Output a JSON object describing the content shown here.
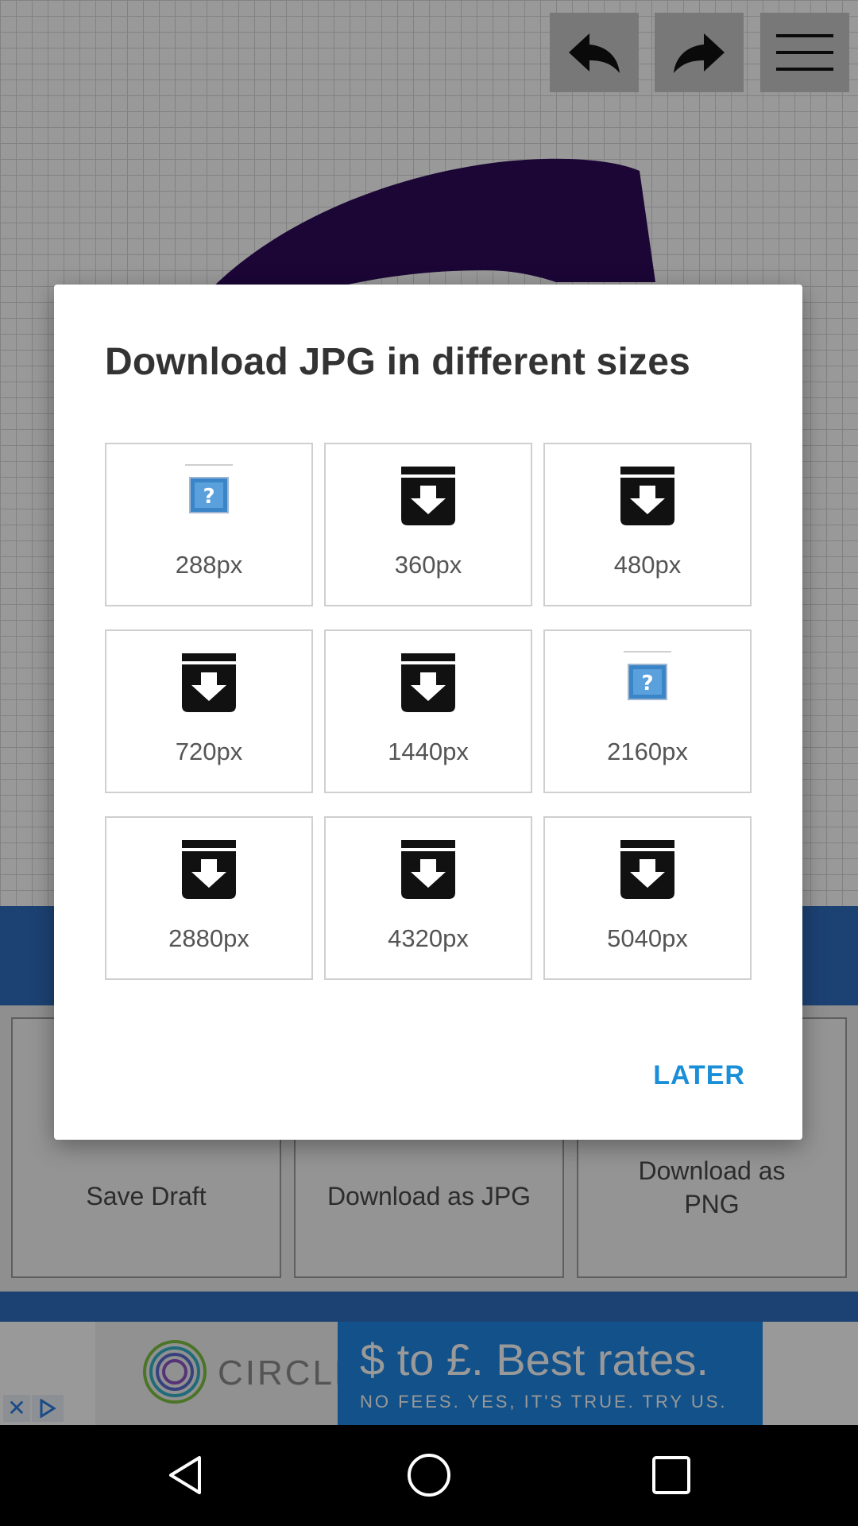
{
  "toolbar": {
    "undo_icon": "undo-arrow-icon",
    "redo_icon": "redo-arrow-icon",
    "menu_icon": "hamburger-menu-icon"
  },
  "background_actions": [
    {
      "label": "Save Draft",
      "icon": "save-icon"
    },
    {
      "label": "Download as JPG",
      "icon": "download-icon"
    },
    {
      "label": "Download as PNG",
      "icon": "download-icon"
    }
  ],
  "ad": {
    "brand": "CIRCLE",
    "headline": "$ to £. Best rates.",
    "subline": "NO FEES. YES, IT'S TRUE. TRY US.",
    "close_icon": "ad-close-icon",
    "adchoices_icon": "adchoices-icon"
  },
  "dialog": {
    "title": "Download JPG in different sizes",
    "later_label": "LATER",
    "sizes": [
      {
        "label": "288px",
        "icon": "broken-image-icon"
      },
      {
        "label": "360px",
        "icon": "download-box-icon"
      },
      {
        "label": "480px",
        "icon": "download-box-icon"
      },
      {
        "label": "720px",
        "icon": "download-box-icon"
      },
      {
        "label": "1440px",
        "icon": "download-box-icon"
      },
      {
        "label": "2160px",
        "icon": "broken-image-icon"
      },
      {
        "label": "2880px",
        "icon": "download-box-icon"
      },
      {
        "label": "4320px",
        "icon": "download-box-icon"
      },
      {
        "label": "5040px",
        "icon": "download-box-icon"
      }
    ]
  },
  "navbar": {
    "back_icon": "back-triangle-icon",
    "home_icon": "home-circle-icon",
    "recents_icon": "recents-square-icon"
  },
  "colors": {
    "accent_blue": "#1a8fd8",
    "band_blue": "#2f6fc2",
    "drawing_purple": "#2e0a5a"
  }
}
